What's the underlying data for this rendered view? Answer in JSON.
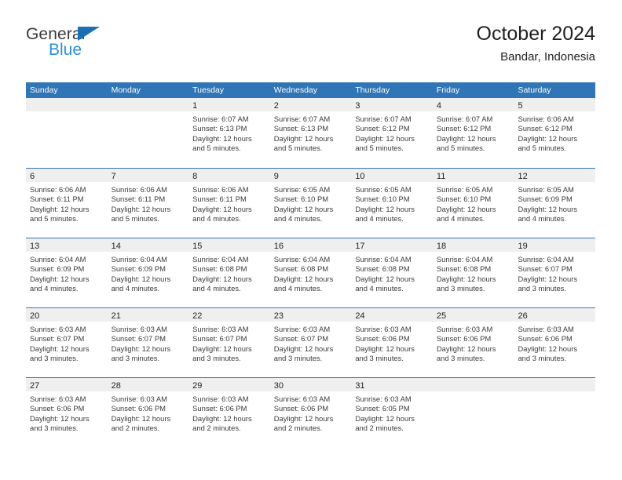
{
  "brand": {
    "name_part1": "General",
    "name_part2": "Blue",
    "triangle_color": "#1a6fb5",
    "blue_color": "#2b8fd6"
  },
  "header": {
    "title": "October 2024",
    "subtitle": "Bandar, Indonesia"
  },
  "theme": {
    "header_blue": "#3075b5",
    "day_band_gray": "#efefef",
    "text_color": "#231f20"
  },
  "weekdays": [
    "Sunday",
    "Monday",
    "Tuesday",
    "Wednesday",
    "Thursday",
    "Friday",
    "Saturday"
  ],
  "weeks": [
    [
      {
        "day": "",
        "empty": true,
        "sunrise": "",
        "sunset": "",
        "daylight": ""
      },
      {
        "day": "",
        "empty": true,
        "sunrise": "",
        "sunset": "",
        "daylight": ""
      },
      {
        "day": "1",
        "sunrise": "Sunrise: 6:07 AM",
        "sunset": "Sunset: 6:13 PM",
        "daylight": "Daylight: 12 hours and 5 minutes."
      },
      {
        "day": "2",
        "sunrise": "Sunrise: 6:07 AM",
        "sunset": "Sunset: 6:13 PM",
        "daylight": "Daylight: 12 hours and 5 minutes."
      },
      {
        "day": "3",
        "sunrise": "Sunrise: 6:07 AM",
        "sunset": "Sunset: 6:12 PM",
        "daylight": "Daylight: 12 hours and 5 minutes."
      },
      {
        "day": "4",
        "sunrise": "Sunrise: 6:07 AM",
        "sunset": "Sunset: 6:12 PM",
        "daylight": "Daylight: 12 hours and 5 minutes."
      },
      {
        "day": "5",
        "sunrise": "Sunrise: 6:06 AM",
        "sunset": "Sunset: 6:12 PM",
        "daylight": "Daylight: 12 hours and 5 minutes."
      }
    ],
    [
      {
        "day": "6",
        "sunrise": "Sunrise: 6:06 AM",
        "sunset": "Sunset: 6:11 PM",
        "daylight": "Daylight: 12 hours and 5 minutes."
      },
      {
        "day": "7",
        "sunrise": "Sunrise: 6:06 AM",
        "sunset": "Sunset: 6:11 PM",
        "daylight": "Daylight: 12 hours and 5 minutes."
      },
      {
        "day": "8",
        "sunrise": "Sunrise: 6:06 AM",
        "sunset": "Sunset: 6:11 PM",
        "daylight": "Daylight: 12 hours and 4 minutes."
      },
      {
        "day": "9",
        "sunrise": "Sunrise: 6:05 AM",
        "sunset": "Sunset: 6:10 PM",
        "daylight": "Daylight: 12 hours and 4 minutes."
      },
      {
        "day": "10",
        "sunrise": "Sunrise: 6:05 AM",
        "sunset": "Sunset: 6:10 PM",
        "daylight": "Daylight: 12 hours and 4 minutes."
      },
      {
        "day": "11",
        "sunrise": "Sunrise: 6:05 AM",
        "sunset": "Sunset: 6:10 PM",
        "daylight": "Daylight: 12 hours and 4 minutes."
      },
      {
        "day": "12",
        "sunrise": "Sunrise: 6:05 AM",
        "sunset": "Sunset: 6:09 PM",
        "daylight": "Daylight: 12 hours and 4 minutes."
      }
    ],
    [
      {
        "day": "13",
        "sunrise": "Sunrise: 6:04 AM",
        "sunset": "Sunset: 6:09 PM",
        "daylight": "Daylight: 12 hours and 4 minutes."
      },
      {
        "day": "14",
        "sunrise": "Sunrise: 6:04 AM",
        "sunset": "Sunset: 6:09 PM",
        "daylight": "Daylight: 12 hours and 4 minutes."
      },
      {
        "day": "15",
        "sunrise": "Sunrise: 6:04 AM",
        "sunset": "Sunset: 6:08 PM",
        "daylight": "Daylight: 12 hours and 4 minutes."
      },
      {
        "day": "16",
        "sunrise": "Sunrise: 6:04 AM",
        "sunset": "Sunset: 6:08 PM",
        "daylight": "Daylight: 12 hours and 4 minutes."
      },
      {
        "day": "17",
        "sunrise": "Sunrise: 6:04 AM",
        "sunset": "Sunset: 6:08 PM",
        "daylight": "Daylight: 12 hours and 4 minutes."
      },
      {
        "day": "18",
        "sunrise": "Sunrise: 6:04 AM",
        "sunset": "Sunset: 6:08 PM",
        "daylight": "Daylight: 12 hours and 3 minutes."
      },
      {
        "day": "19",
        "sunrise": "Sunrise: 6:04 AM",
        "sunset": "Sunset: 6:07 PM",
        "daylight": "Daylight: 12 hours and 3 minutes."
      }
    ],
    [
      {
        "day": "20",
        "sunrise": "Sunrise: 6:03 AM",
        "sunset": "Sunset: 6:07 PM",
        "daylight": "Daylight: 12 hours and 3 minutes."
      },
      {
        "day": "21",
        "sunrise": "Sunrise: 6:03 AM",
        "sunset": "Sunset: 6:07 PM",
        "daylight": "Daylight: 12 hours and 3 minutes."
      },
      {
        "day": "22",
        "sunrise": "Sunrise: 6:03 AM",
        "sunset": "Sunset: 6:07 PM",
        "daylight": "Daylight: 12 hours and 3 minutes."
      },
      {
        "day": "23",
        "sunrise": "Sunrise: 6:03 AM",
        "sunset": "Sunset: 6:07 PM",
        "daylight": "Daylight: 12 hours and 3 minutes."
      },
      {
        "day": "24",
        "sunrise": "Sunrise: 6:03 AM",
        "sunset": "Sunset: 6:06 PM",
        "daylight": "Daylight: 12 hours and 3 minutes."
      },
      {
        "day": "25",
        "sunrise": "Sunrise: 6:03 AM",
        "sunset": "Sunset: 6:06 PM",
        "daylight": "Daylight: 12 hours and 3 minutes."
      },
      {
        "day": "26",
        "sunrise": "Sunrise: 6:03 AM",
        "sunset": "Sunset: 6:06 PM",
        "daylight": "Daylight: 12 hours and 3 minutes."
      }
    ],
    [
      {
        "day": "27",
        "sunrise": "Sunrise: 6:03 AM",
        "sunset": "Sunset: 6:06 PM",
        "daylight": "Daylight: 12 hours and 3 minutes."
      },
      {
        "day": "28",
        "sunrise": "Sunrise: 6:03 AM",
        "sunset": "Sunset: 6:06 PM",
        "daylight": "Daylight: 12 hours and 2 minutes."
      },
      {
        "day": "29",
        "sunrise": "Sunrise: 6:03 AM",
        "sunset": "Sunset: 6:06 PM",
        "daylight": "Daylight: 12 hours and 2 minutes."
      },
      {
        "day": "30",
        "sunrise": "Sunrise: 6:03 AM",
        "sunset": "Sunset: 6:06 PM",
        "daylight": "Daylight: 12 hours and 2 minutes."
      },
      {
        "day": "31",
        "sunrise": "Sunrise: 6:03 AM",
        "sunset": "Sunset: 6:05 PM",
        "daylight": "Daylight: 12 hours and 2 minutes."
      },
      {
        "day": "",
        "empty": true,
        "sunrise": "",
        "sunset": "",
        "daylight": ""
      },
      {
        "day": "",
        "empty": true,
        "sunrise": "",
        "sunset": "",
        "daylight": ""
      }
    ]
  ]
}
